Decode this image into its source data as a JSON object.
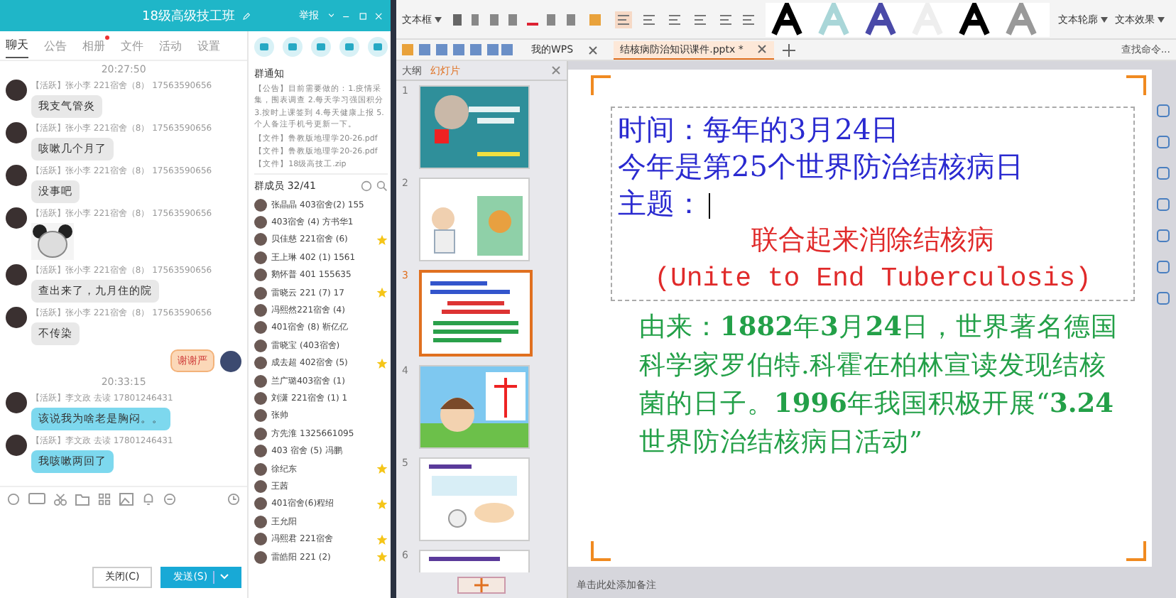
{
  "chat": {
    "title": "18级高级技工班",
    "report": "举报",
    "tabs": [
      {
        "label": "聊天",
        "selected": true,
        "unread": false
      },
      {
        "label": "公告",
        "selected": false,
        "unread": false
      },
      {
        "label": "相册",
        "selected": false,
        "unread": true
      },
      {
        "label": "文件",
        "selected": false,
        "unread": false
      },
      {
        "label": "活动",
        "selected": false,
        "unread": false
      },
      {
        "label": "设置",
        "selected": false,
        "unread": false
      }
    ],
    "messages": [
      {
        "kind": "time",
        "text": "20:27:50"
      },
      {
        "kind": "text",
        "sender": "【活跃】张小李 221宿舍（8） 17563590656",
        "text": "我支气管炎",
        "color": "#e8e8e8"
      },
      {
        "kind": "text",
        "sender": "【活跃】张小李 221宿舍（8） 17563590656",
        "text": "咳嗽几个月了",
        "color": "#e8e8e8"
      },
      {
        "kind": "text",
        "sender": "【活跃】张小李 221宿舍（8） 17563590656",
        "text": "没事吧",
        "color": "#e8e8e8"
      },
      {
        "kind": "sticker",
        "sender": "【活跃】张小李 221宿舍（8） 17563590656"
      },
      {
        "kind": "text",
        "sender": "【活跃】张小李 221宿舍（8） 17563590656",
        "text": "查出来了，九月住的院",
        "color": "#e8e8e8"
      },
      {
        "kind": "text",
        "sender": "【活跃】张小李 221宿舍（8） 17563590656",
        "text": "不传染",
        "color": "#e8e8e8"
      },
      {
        "kind": "own",
        "text": "谢谢严"
      },
      {
        "kind": "time",
        "text": "20:33:15"
      },
      {
        "kind": "text",
        "sender": "【活跃】李文政 去读 17801246431",
        "text": "该说我为啥老是胸闷。。",
        "color": "#7dd8ee"
      },
      {
        "kind": "text",
        "sender": "【活跃】李文政 去读 17801246431",
        "text": "我咳嗽两回了",
        "color": "#7dd8ee"
      }
    ],
    "buttons": [
      {
        "label": "关闭(C)",
        "primary": false
      },
      {
        "label": "发送(S)",
        "primary": true
      }
    ]
  },
  "group": {
    "notice_title": "群通知",
    "notice": "【公告】目前需要做的：1.疫情采集，围表调查 2.每天学习强国积分 3.按时上课签到 4.每天健康上报 5.个人备注手机号更新一下。",
    "files": [
      "【文件】鲁教版地理学20-26.pdf",
      "【文件】鲁教版地理学20-26.pdf",
      "【文件】18级高技工.zip"
    ],
    "members_title": "群成员 32/41",
    "members": [
      {
        "text": "张晶晶 403宿舍(2) 155",
        "starred": false
      },
      {
        "text": "403宿舍 (4) 方书华1",
        "starred": false
      },
      {
        "text": "贝佳慈 221宿舍 (6)",
        "starred": true
      },
      {
        "text": "王上琳 402 (1) 1561",
        "starred": false
      },
      {
        "text": "鹅怀普 401 155635",
        "starred": false
      },
      {
        "text": "雷晓云 221 (7) 17",
        "starred": true
      },
      {
        "text": "冯熙然221宿舍 (4)",
        "starred": false
      },
      {
        "text": "401宿舍 (8) 靳亿亿",
        "starred": false
      },
      {
        "text": "雷晓宝 (403宿舍)",
        "starred": false
      },
      {
        "text": "成去超 402宿舍 (5)",
        "starred": true
      },
      {
        "text": "兰广璐403宿舍 (1)",
        "starred": false
      },
      {
        "text": "刘潇 221宿舍 (1) 1",
        "starred": false
      },
      {
        "text": "张帅",
        "starred": false
      },
      {
        "text": "方先淮 1325661095",
        "starred": false
      },
      {
        "text": "403 宿舍 (5) 冯鹏",
        "starred": false
      },
      {
        "text": "徐纪东",
        "starred": true
      },
      {
        "text": "王茜",
        "starred": false
      },
      {
        "text": "401宿舍(6)程绍",
        "starred": true
      },
      {
        "text": "王允阳",
        "starred": false
      },
      {
        "text": "冯熙君 221宿舍",
        "starred": true
      },
      {
        "text": "雷皓阳 221 (2)",
        "starred": true
      }
    ]
  },
  "wps": {
    "ribbon": {
      "textbox": "文本框",
      "outline": "文本轮廓",
      "effect": "文本效果"
    },
    "tabs": [
      {
        "label": "我的WPS",
        "selected": false
      },
      {
        "label": "结核病防治知识课件.pptx *",
        "selected": true
      }
    ],
    "search": "查找命令...",
    "pane_tabs": [
      {
        "label": "大纲",
        "selected": false
      },
      {
        "label": "幻灯片",
        "selected": true
      }
    ],
    "slides": [
      {
        "number": "1",
        "selected": false
      },
      {
        "number": "2",
        "selected": false
      },
      {
        "number": "3",
        "selected": true
      },
      {
        "number": "4",
        "selected": false
      },
      {
        "number": "5",
        "selected": false
      },
      {
        "number": "6",
        "selected": false
      }
    ],
    "slide": {
      "lines": [
        "时间：每年的3月24日",
        "今年是第25个世界防治结核病日",
        "主题："
      ],
      "theme_cn": "联合起来消除结核病",
      "theme_en": "(Unite to End Tuberculosis)",
      "origin": "由来：**1882**年**3**月**24**日，世界著名德国科学家罗伯特.科霍在柏林宣读发现结核菌的日子。**1996**年我国积极开展“**3.24**世界防治结核病日活动”"
    },
    "notes_placeholder": "单击此处添加备注"
  }
}
